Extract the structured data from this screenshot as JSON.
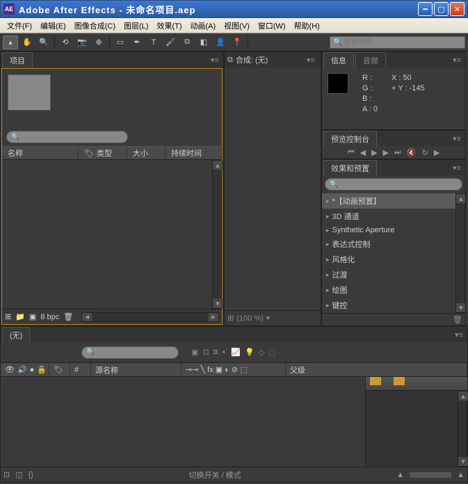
{
  "window": {
    "app_icon": "AE",
    "title": "Adobe After Effects - 未命名项目.aep"
  },
  "menu": [
    "文件(F)",
    "编辑(E)",
    "图像合成(C)",
    "图层(L)",
    "效果(T)",
    "动画(A)",
    "视图(V)",
    "窗口(W)",
    "帮助(H)"
  ],
  "search_help_placeholder": "搜索帮助",
  "project": {
    "tab": "项目",
    "cols": {
      "name": "名称",
      "type": "类型",
      "size": "大小",
      "duration": "持续时间"
    },
    "bpc": "8 bpc"
  },
  "composition": {
    "label": "合成: (无)",
    "zoom": "(100 %)"
  },
  "info": {
    "tab1": "信息",
    "tab2": "音频",
    "r": "R :",
    "g": "G :",
    "b": "B :",
    "a": "A : 0",
    "x": "X : 50",
    "y": "Y : -145"
  },
  "preview": {
    "tab": "预览控制台"
  },
  "effects": {
    "tab": "效果和预置",
    "items": [
      "*【动画预置】",
      "3D 通道",
      "Synthetic Aperture",
      "表达式控制",
      "风格化",
      "过渡",
      "绘图",
      "键控"
    ]
  },
  "timeline": {
    "tab": "(无)",
    "cols": {
      "source": "#",
      "source_name": "源名称",
      "switches": "父级"
    },
    "col_icons_label": "",
    "footer_center": "切换开关 / 模式"
  }
}
